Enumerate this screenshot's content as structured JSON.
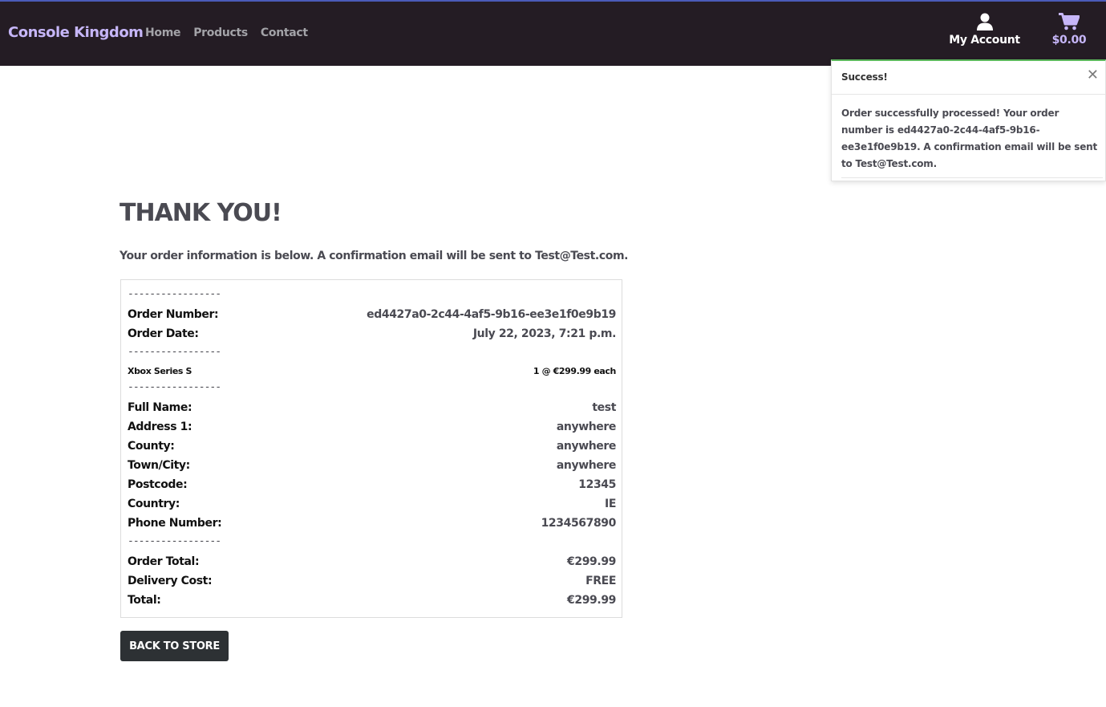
{
  "navbar": {
    "brand": "Console Kingdom",
    "links": [
      "Home",
      "Products",
      "Contact"
    ],
    "account_label": "My Account",
    "cart_total": "$0.00",
    "icons": {
      "account": "user-icon",
      "cart": "shopping-cart-icon"
    }
  },
  "toast": {
    "title": "Success!",
    "message": "Order successfully processed! Your order number is ed4427a0-2c44-4af5-9b16-ee3e1f0e9b19. A confirmation email will be sent to Test@Test.com.",
    "close_icon": "close-icon"
  },
  "page": {
    "heading": "THANK YOU!",
    "intro": "Your order information is below. A confirmation email will be sent to Test@Test.com."
  },
  "receipt": {
    "separator": "-----------------",
    "order_number_label": "Order Number:",
    "order_number": "ed4427a0-2c44-4af5-9b16-ee3e1f0e9b19",
    "order_date_label": "Order Date:",
    "order_date": "July 22, 2023, 7:21 p.m.",
    "item_name": "Xbox Series S",
    "item_qty_price": "1 @ €299.99 each",
    "full_name_label": "Full Name:",
    "full_name": "test",
    "address1_label": "Address 1:",
    "address1": "anywhere",
    "county_label": "County:",
    "county": "anywhere",
    "town_label": "Town/City:",
    "town": "anywhere",
    "postcode_label": "Postcode:",
    "postcode": "12345",
    "country_label": "Country:",
    "country": "IE",
    "phone_label": "Phone Number:",
    "phone": "1234567890",
    "order_total_label": "Order Total:",
    "order_total": "€299.99",
    "delivery_label": "Delivery Cost:",
    "delivery": "FREE",
    "total_label": "Total:",
    "total": "€299.99"
  },
  "actions": {
    "back_to_store": "BACK TO STORE"
  },
  "colors": {
    "navbar_bg": "#241c24",
    "brand": "#c6b6f8",
    "success": "#5cb85c",
    "button_bg": "#2d3134"
  }
}
